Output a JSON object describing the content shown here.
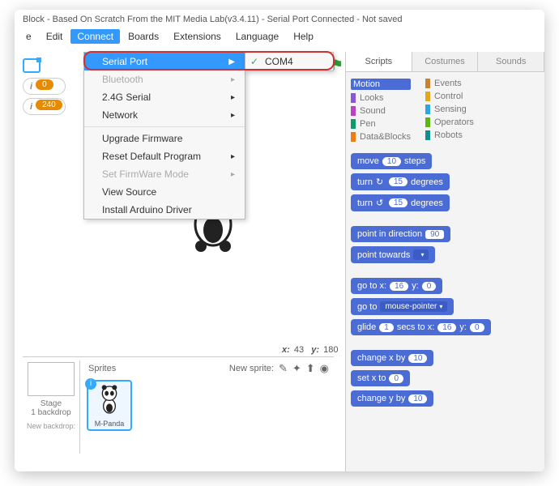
{
  "title": "Block - Based On Scratch From the MIT Media Lab(v3.4.11) - Serial Port Connected - Not saved",
  "menu": {
    "file": "e",
    "edit": "Edit",
    "connect": "Connect",
    "boards": "Boards",
    "extensions": "Extensions",
    "language": "Language",
    "help": "Help"
  },
  "dropdown": {
    "serial_port": "Serial Port",
    "bluetooth": "Bluetooth",
    "serial24g": "2.4G Serial",
    "network": "Network",
    "upgrade": "Upgrade Firmware",
    "reset": "Reset Default Program",
    "setfw": "Set FirmWare Mode",
    "viewsrc": "View Source",
    "install": "Install Arduino Driver"
  },
  "submenu": {
    "com4": "COM4"
  },
  "pills": {
    "a": "0",
    "b": "240"
  },
  "stage": {
    "x_label": "x:",
    "x": "43",
    "y_label": "y:",
    "y": "180"
  },
  "sprites": {
    "header": "Sprites",
    "new_label": "New sprite:",
    "stage_label": "Stage",
    "backdrop_label": "1 backdrop",
    "newbackdrop": "New backdrop:",
    "sprite_name": "M-Panda"
  },
  "tabs": {
    "scripts": "Scripts",
    "costumes": "Costumes",
    "sounds": "Sounds"
  },
  "cats": {
    "motion": "Motion",
    "looks": "Looks",
    "sound": "Sound",
    "pen": "Pen",
    "data": "Data&Blocks",
    "events": "Events",
    "control": "Control",
    "sensing": "Sensing",
    "operators": "Operators",
    "robots": "Robots"
  },
  "blocks": {
    "move": "move",
    "steps": "steps",
    "move_n": "10",
    "turn": "turn",
    "degrees": "degrees",
    "turn_n1": "15",
    "turn_n2": "15",
    "point_dir": "point in direction",
    "dir_n": "90",
    "point_tw": "point towards",
    "goto_xy": "go to x:",
    "y_lbl": "y:",
    "gx": "16",
    "gy": "0",
    "goto": "go to",
    "goto_opt": "mouse-pointer",
    "glide": "glide",
    "glide_n": "1",
    "secs": "secs to x:",
    "glx": "16",
    "gly": "0",
    "changex": "change x by",
    "cx": "10",
    "setx": "set x to",
    "sx": "0",
    "changey": "change y by",
    "cy": "10"
  }
}
